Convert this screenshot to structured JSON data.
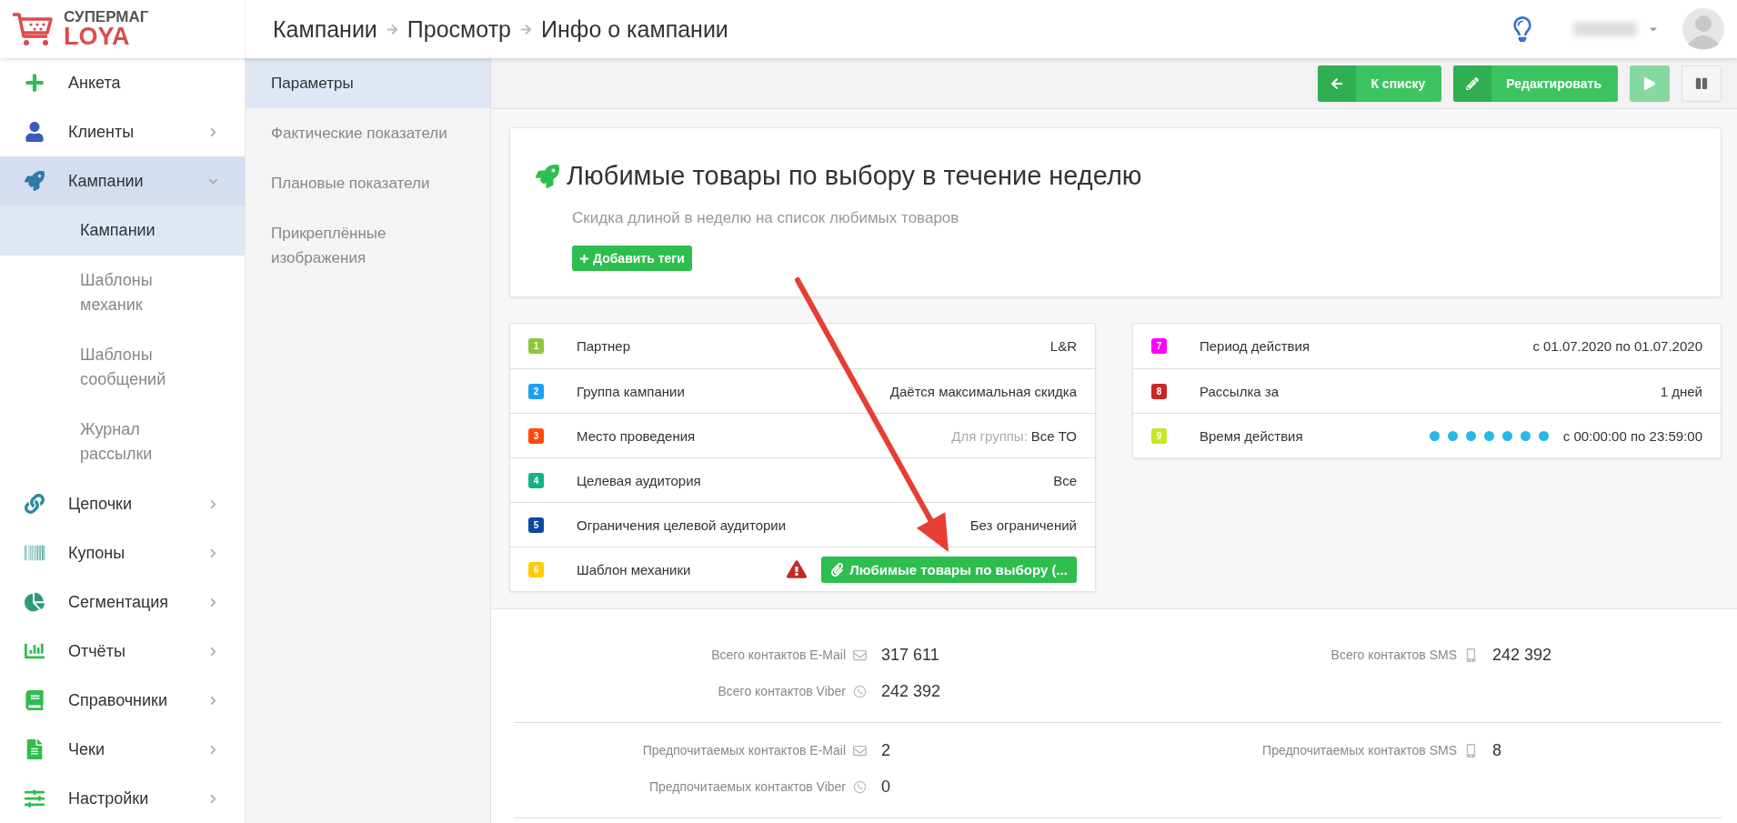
{
  "header": {
    "logo": {
      "top": "СУПЕРМАГ",
      "bottom": "LOYA"
    },
    "breadcrumbs": [
      "Кампании",
      "Просмотр",
      "Инфо о кампании"
    ]
  },
  "sidebar": {
    "items": [
      {
        "kind": "link",
        "label": "Анкета",
        "expanded": false
      },
      {
        "kind": "group",
        "label": "Клиенты",
        "expanded": false
      },
      {
        "kind": "group",
        "label": "Кампании",
        "expanded": true,
        "children": [
          {
            "label": "Кампании",
            "selected": true
          },
          {
            "label": "Шаблоны механик",
            "selected": false
          },
          {
            "label": "Шаблоны сообщений",
            "selected": false
          },
          {
            "label": "Журнал рассылки",
            "selected": false
          }
        ]
      },
      {
        "kind": "group",
        "label": "Цепочки",
        "expanded": false
      },
      {
        "kind": "group",
        "label": "Купоны",
        "expanded": false
      },
      {
        "kind": "group",
        "label": "Сегментация",
        "expanded": false
      },
      {
        "kind": "group",
        "label": "Отчёты",
        "expanded": false
      },
      {
        "kind": "group",
        "label": "Справочники",
        "expanded": false
      },
      {
        "kind": "group",
        "label": "Чеки",
        "expanded": false
      },
      {
        "kind": "group",
        "label": "Настройки",
        "expanded": false
      }
    ]
  },
  "sections_nav": {
    "items": [
      {
        "label": "Параметры",
        "selected": true
      },
      {
        "label": "Фактические показатели",
        "selected": false
      },
      {
        "label": "Плановые показатели",
        "selected": false
      },
      {
        "label": "Прикреплённые изображения",
        "selected": false
      }
    ]
  },
  "toolbar": {
    "buttons": [
      {
        "kind": "back",
        "label": "К списку",
        "disabled": false
      },
      {
        "kind": "edit",
        "label": "Редактировать",
        "disabled": false
      },
      {
        "kind": "play",
        "disabled": true
      },
      {
        "kind": "pause",
        "disabled": false
      }
    ]
  },
  "campaign": {
    "title": "Любимые товары по выбору в течение неделю",
    "description": "Скидка длиной в неделю на список любимых товаров",
    "tag_button": "Добавить теги"
  },
  "params_left": [
    {
      "number": "1",
      "color": "#8dc63f",
      "label": "Партнер",
      "kind": "text",
      "value": "L&R",
      "warning": false
    },
    {
      "number": "2",
      "color": "#1e9ff2",
      "label": "Группа кампании",
      "kind": "text",
      "value": "Даётся максимальная скидка",
      "warning": false
    },
    {
      "number": "3",
      "color": "#ff4a0a",
      "label": "Место проведения",
      "kind": "scoped",
      "scope": "Для группы:",
      "value": "Все ТО",
      "warning": false
    },
    {
      "number": "4",
      "color": "#17b08a",
      "label": "Целевая аудитория",
      "kind": "text",
      "value": "Все",
      "warning": false
    },
    {
      "number": "5",
      "color": "#0d47a1",
      "label": "Ограничения целевой аудитории",
      "kind": "text",
      "value": "Без ограничений",
      "warning": false
    },
    {
      "number": "6",
      "color": "#ffcc00",
      "label": "Шаблон механики",
      "kind": "link",
      "value": "Любимые товары по выбору (...",
      "warning": true
    }
  ],
  "params_right": [
    {
      "number": "7",
      "color": "#ff00ff",
      "label": "Период действия",
      "kind": "text",
      "value": "с 01.07.2020 по 01.07.2020",
      "warning": false
    },
    {
      "number": "8",
      "color": "#c62828",
      "label": "Рассылка за",
      "kind": "text",
      "value": "1 дней",
      "warning": false
    },
    {
      "number": "9",
      "color": "#c6e627",
      "label": "Время действия",
      "kind": "schedule",
      "weekdays": [
        {
          "on": true
        },
        {
          "on": true
        },
        {
          "on": true
        },
        {
          "on": true
        },
        {
          "on": true
        },
        {
          "on": true
        },
        {
          "on": true
        }
      ],
      "value": "с 00:00:00 по 23:59:00",
      "warning": false
    }
  ],
  "contacts": [
    {
      "left": [
        {
          "kind": "email",
          "label": "Всего контактов E-Mail",
          "value": "317 611"
        },
        {
          "kind": "viber",
          "label": "Всего контактов Viber",
          "value": "242 392"
        }
      ],
      "right": [
        {
          "kind": "sms",
          "label": "Всего контактов SMS",
          "value": "242 392"
        }
      ]
    },
    {
      "left": [
        {
          "kind": "email",
          "label": "Предпочитаемых контактов E-Mail",
          "value": "2"
        },
        {
          "kind": "viber",
          "label": "Предпочитаемых контактов Viber",
          "value": "0"
        }
      ],
      "right": [
        {
          "kind": "sms",
          "label": "Предпочитаемых контактов SMS",
          "value": "8"
        }
      ]
    }
  ]
}
